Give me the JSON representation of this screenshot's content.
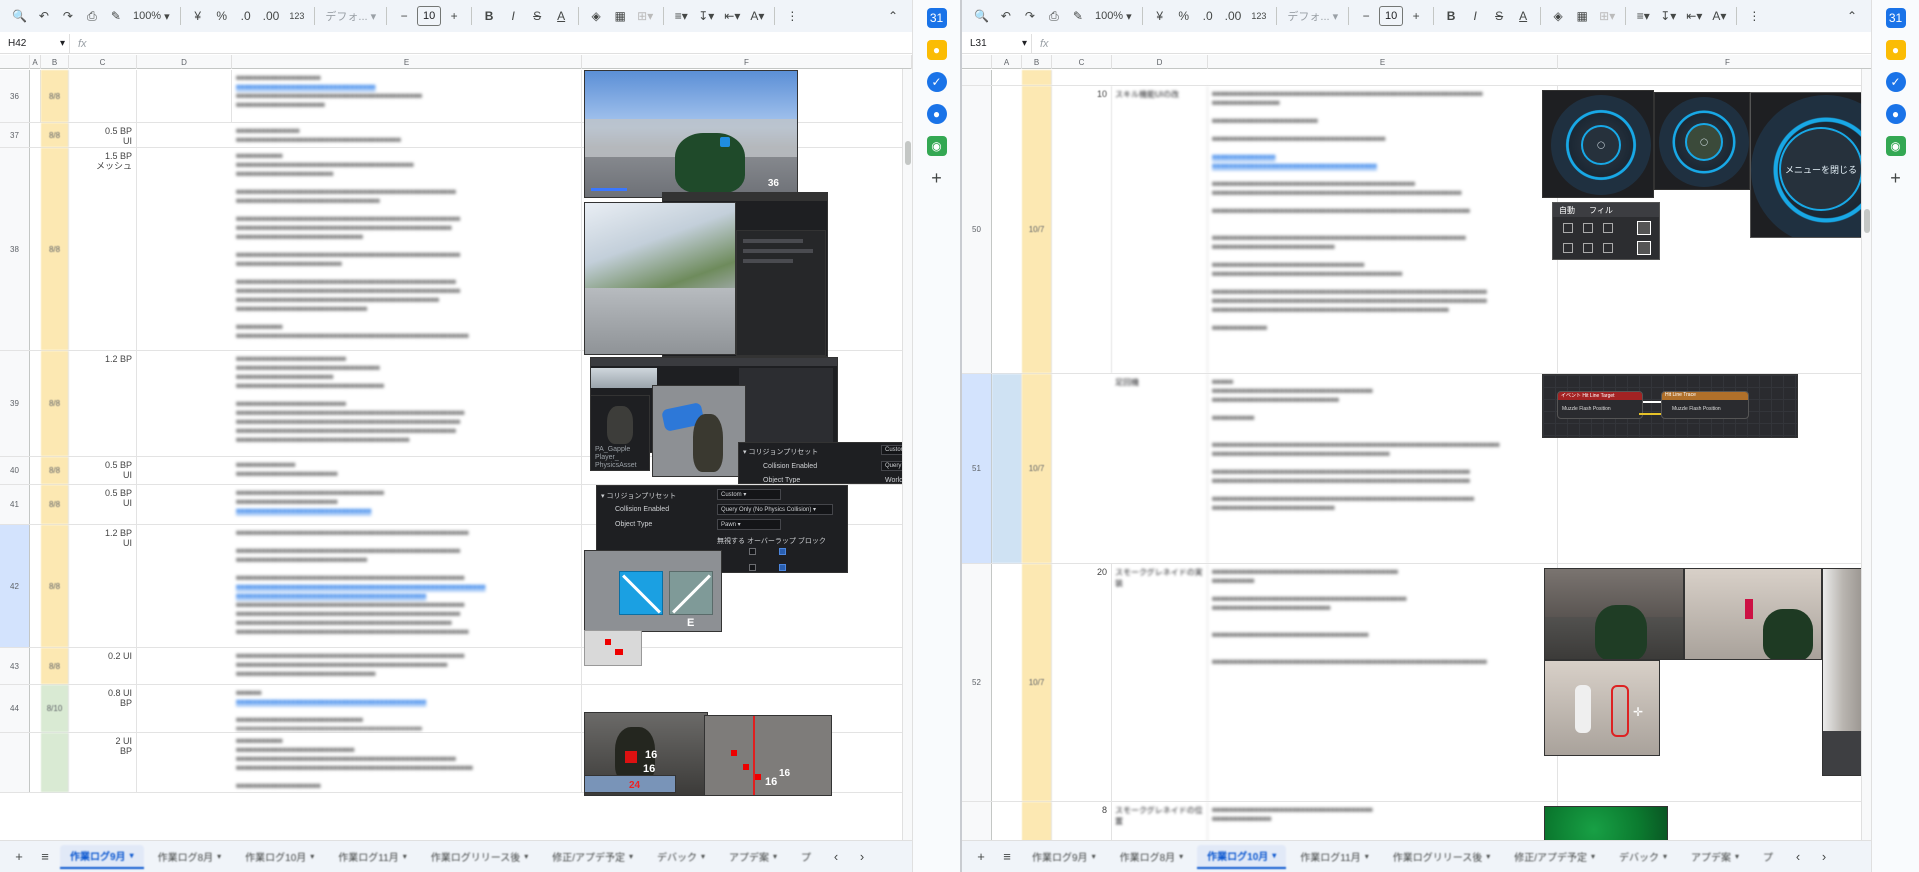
{
  "toolbar": {
    "zoom": "100%",
    "currency": "¥",
    "percent": "%",
    "dec_decrease": ".0",
    "dec_increase": ".00",
    "number_format": "123",
    "font": "デフォ...",
    "font_size": "10",
    "minus": "−",
    "plus": "+"
  },
  "left": {
    "cell_ref": "H42",
    "fx": "fx",
    "columns": [
      "A",
      "B",
      "C",
      "D",
      "E",
      "F"
    ],
    "rows": [
      {
        "num": "36",
        "b": "8/8",
        "c": ""
      },
      {
        "num": "37",
        "b": "8/8",
        "c": "0.5 BP\nUI"
      },
      {
        "num": "38",
        "b": "8/8",
        "c": "1.5 BP\nメッシュ"
      },
      {
        "num": "39",
        "b": "8/8",
        "c": "1.2 BP"
      },
      {
        "num": "40",
        "b": "8/8",
        "c": "0.5 BP\nUI"
      },
      {
        "num": "41",
        "b": "8/8",
        "c": "0.5 BP\nUI"
      },
      {
        "num": "42",
        "b": "8/8",
        "c": "1.2 BP\nUI"
      },
      {
        "num": "43",
        "b": "8/8",
        "c": "0.2 UI"
      },
      {
        "num": "44",
        "b": "8/10",
        "c": "0.8 UI\nBP"
      },
      {
        "num": "",
        "b": "",
        "c": "2 UI\nBP"
      }
    ],
    "ue": {
      "collision_preset": "コリジョンプリセット",
      "custom": "Custom",
      "custom_short": "Custom...",
      "collision_enabled": "Collision Enabled",
      "query_only": "Query Only (No Physics Collision)",
      "query_short": "Query O",
      "object_type": "Object Type",
      "object_type_short": "Object Type",
      "pawn": "Pawn",
      "world": "WorldS",
      "ignore": "無視する",
      "overlap_block": "オーバーラップ ブロック",
      "asset_name": "PA_Gapple\nPlayer_\nPhysicsAsset",
      "ammo": "36",
      "key_e": "E",
      "hit_16a": "16",
      "hit_16b": "16",
      "hit_16c": "16",
      "hit_16d": "16",
      "hit_24": "24"
    },
    "tabs": [
      "作業ログ9月",
      "作業ログ8月",
      "作業ログ10月",
      "作業ログ11月",
      "作業ログリリース後",
      "修正/アプデ予定",
      "デバック",
      "アプデ案",
      "プ"
    ]
  },
  "right": {
    "cell_ref": "L31",
    "fx": "fx",
    "columns": [
      "A",
      "B",
      "C",
      "D",
      "E",
      "F"
    ],
    "rows": [
      {
        "num": "",
        "b": "",
        "c": "",
        "d": ""
      },
      {
        "num": "50",
        "b": "10/7",
        "c": "10",
        "d": "スキル機能UIの改"
      },
      {
        "num": "51",
        "b": "10/7",
        "c": "",
        "d": "足回機"
      },
      {
        "num": "52",
        "b": "10/7",
        "c": "20",
        "d": "スモークグレネイドの実装"
      },
      {
        "num": "",
        "b": "",
        "c": "8",
        "d": "スモークグレネイドの位置"
      }
    ],
    "ui": {
      "menu_close": "メニューを閉じる",
      "auto": "自動",
      "fill": "フィル",
      "bp_left": "イベント Hit Line Target",
      "bp_right": "Hit Line Trace",
      "bp_pin1": "Muzzle Flash Position",
      "bp_pin2": "Muzzle Flash Position"
    },
    "tabs": [
      "作業ログ9月",
      "作業ログ8月",
      "作業ログ10月",
      "作業ログ11月",
      "作業ログリリース後",
      "修正/アプデ予定",
      "デバック",
      "アプデ案",
      "プ"
    ]
  },
  "colors": {
    "date_yellow": "#fce8b2",
    "date_green": "#d9ead3",
    "date_blue": "#cfe2f3",
    "accent": "#0b57d0",
    "radial_cyan": "#18a8e6"
  }
}
